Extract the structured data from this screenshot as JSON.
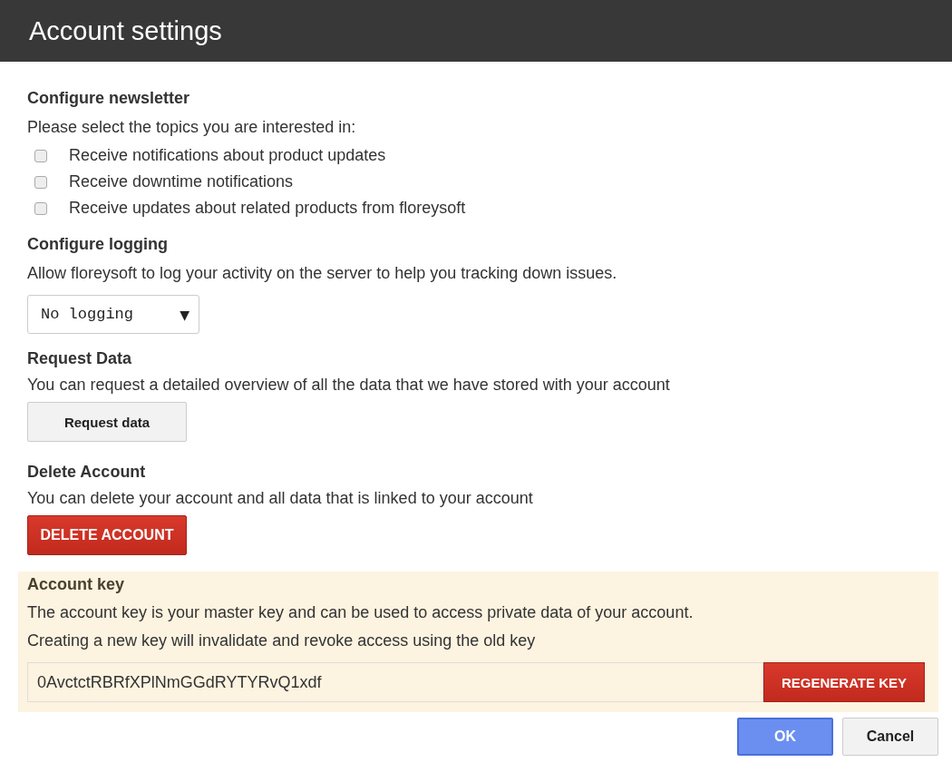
{
  "window": {
    "title": "Account settings"
  },
  "newsletter": {
    "heading": "Configure newsletter",
    "description": "Please select the topics you are interested in:",
    "options": [
      {
        "label": "Receive notifications about product updates",
        "checked": false
      },
      {
        "label": "Receive downtime notifications",
        "checked": false
      },
      {
        "label": "Receive updates about related products from floreysoft",
        "checked": false
      }
    ]
  },
  "logging": {
    "heading": "Configure logging",
    "description": "Allow floreysoft to log your activity on the server to help you tracking down issues.",
    "select": {
      "value": "No logging",
      "arrow": "▼"
    }
  },
  "request_data": {
    "heading": "Request Data",
    "description": "You can request a detailed overview of all the data that we have stored with your account",
    "button": "Request data"
  },
  "delete_account": {
    "heading": "Delete Account",
    "description": "You can delete your account and all data that is linked to your account",
    "button": "DELETE ACCOUNT"
  },
  "account_key": {
    "heading": "Account key",
    "description": "The account key is your master key and can be used to access private data of your account.",
    "note": "Creating a new key will invalidate and revoke access using the old key",
    "value": "0AvctctRBRfXPlNmGGdRYTYRvQ1xdf",
    "button": "REGENERATE KEY"
  },
  "buttons": [
    "OK",
    "Cancel"
  ]
}
